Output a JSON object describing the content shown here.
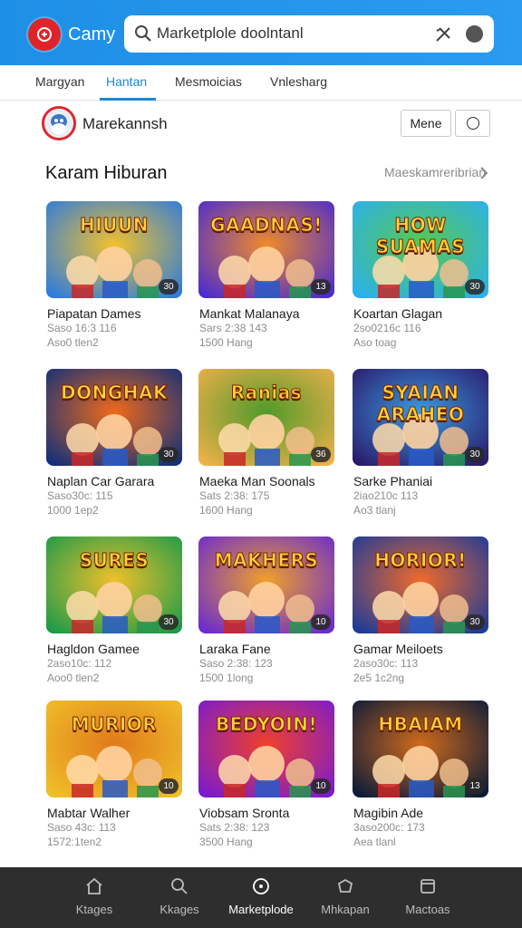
{
  "app": {
    "name": "Camy",
    "logo_icon": "game-controller-icon",
    "brand_color": "#1e8fe6"
  },
  "search": {
    "value": "Marketplole doolntanl",
    "placeholder": "Marketplole doolntanl"
  },
  "tabs": [
    {
      "label": "Margyan",
      "active": false
    },
    {
      "label": "Hantan",
      "active": true
    },
    {
      "label": "Mesmoicias",
      "active": false
    },
    {
      "label": "Vnlesharg",
      "active": false
    }
  ],
  "profile": {
    "name": "Marekannsh",
    "more_label": "Mene"
  },
  "section": {
    "title": "Karam Hiburan",
    "link": "Maeskamreribrian"
  },
  "games": [
    {
      "thumb_title": "HIUUN",
      "badge": "30",
      "title": "Piapatan Dames",
      "meta1": "Saso 16:3 116",
      "meta2": "Aso0 tlen2",
      "palette": [
        "#2b7be0",
        "#f3c12a"
      ]
    },
    {
      "thumb_title": "GAADNAS!",
      "badge": "13",
      "title": "Mankat Malanaya",
      "meta1": "Sars 2:38 143",
      "meta2": "1500 Hang",
      "palette": [
        "#4a2bd0",
        "#f08a2a"
      ]
    },
    {
      "thumb_title": "HOW SUAMAS",
      "badge": "30",
      "title": "Koartan Glagan",
      "meta1": "2so0216c 116",
      "meta2": "Aso toag",
      "palette": [
        "#2ab0f0",
        "#58c94a"
      ]
    },
    {
      "thumb_title": "DONGHAK",
      "badge": "30",
      "title": "Naplan Car Garara",
      "meta1": "Saso30c: 115",
      "meta2": "1000 1ep2",
      "palette": [
        "#102f7a",
        "#f06a1a"
      ]
    },
    {
      "thumb_title": "Ranias",
      "badge": "36",
      "title": "Maeka Man Soonals",
      "meta1": "Sats 2:38: 175",
      "meta2": "1600 Hang",
      "palette": [
        "#f0b04a",
        "#4f9a2a"
      ]
    },
    {
      "thumb_title": "SYAIAN ARAHEO",
      "badge": "30",
      "title": "Sarke Phaniai",
      "meta1": "2iao210c 113",
      "meta2": "Ao3 tlanj",
      "palette": [
        "#2a1a6a",
        "#3a9be0"
      ]
    },
    {
      "thumb_title": "SURES",
      "badge": "30",
      "title": "Hagldon Gamee",
      "meta1": "2aso10c: 112",
      "meta2": "Aoo0 tlen2",
      "palette": [
        "#1a9a4a",
        "#f0c02a"
      ]
    },
    {
      "thumb_title": "MAKHERS",
      "badge": "10",
      "title": "Laraka Fane",
      "meta1": "Saso 2:38: 123",
      "meta2": "1500 1long",
      "palette": [
        "#6a2ad0",
        "#f0a02a"
      ]
    },
    {
      "thumb_title": "HORIOR!",
      "badge": "30",
      "title": "Gamar Meiloets",
      "meta1": "2aso30c: 113",
      "meta2": "2e5 1c2ng",
      "palette": [
        "#1a3a9a",
        "#f06a2a"
      ]
    },
    {
      "thumb_title": "MURIOR",
      "badge": "10",
      "title": "Mabtar Walher",
      "meta1": "Saso 43c: 113",
      "meta2": "1572:1ten2",
      "palette": [
        "#f0c02a",
        "#e07a1a"
      ]
    },
    {
      "thumb_title": "BEDYOIN!",
      "badge": "10",
      "title": "Viobsam Sronta",
      "meta1": "Sats 2:38: 123",
      "meta2": "3500 Hang",
      "palette": [
        "#7a1ad0",
        "#f0402a"
      ]
    },
    {
      "thumb_title": "HBAIAM",
      "badge": "13",
      "title": "Magibin Ade",
      "meta1": "3aso200c: 173",
      "meta2": "Aea tlanl",
      "palette": [
        "#0a1a3a",
        "#d06a1a"
      ]
    }
  ],
  "bottom_nav": [
    {
      "label": "Ktages",
      "icon": "home-icon",
      "active": false
    },
    {
      "label": "Kkages",
      "icon": "search-icon",
      "active": false
    },
    {
      "label": "Marketplode",
      "icon": "compass-icon",
      "active": true
    },
    {
      "label": "Mhkapan",
      "icon": "gamepad-icon",
      "active": false
    },
    {
      "label": "Mactoas",
      "icon": "library-icon",
      "active": false
    }
  ]
}
